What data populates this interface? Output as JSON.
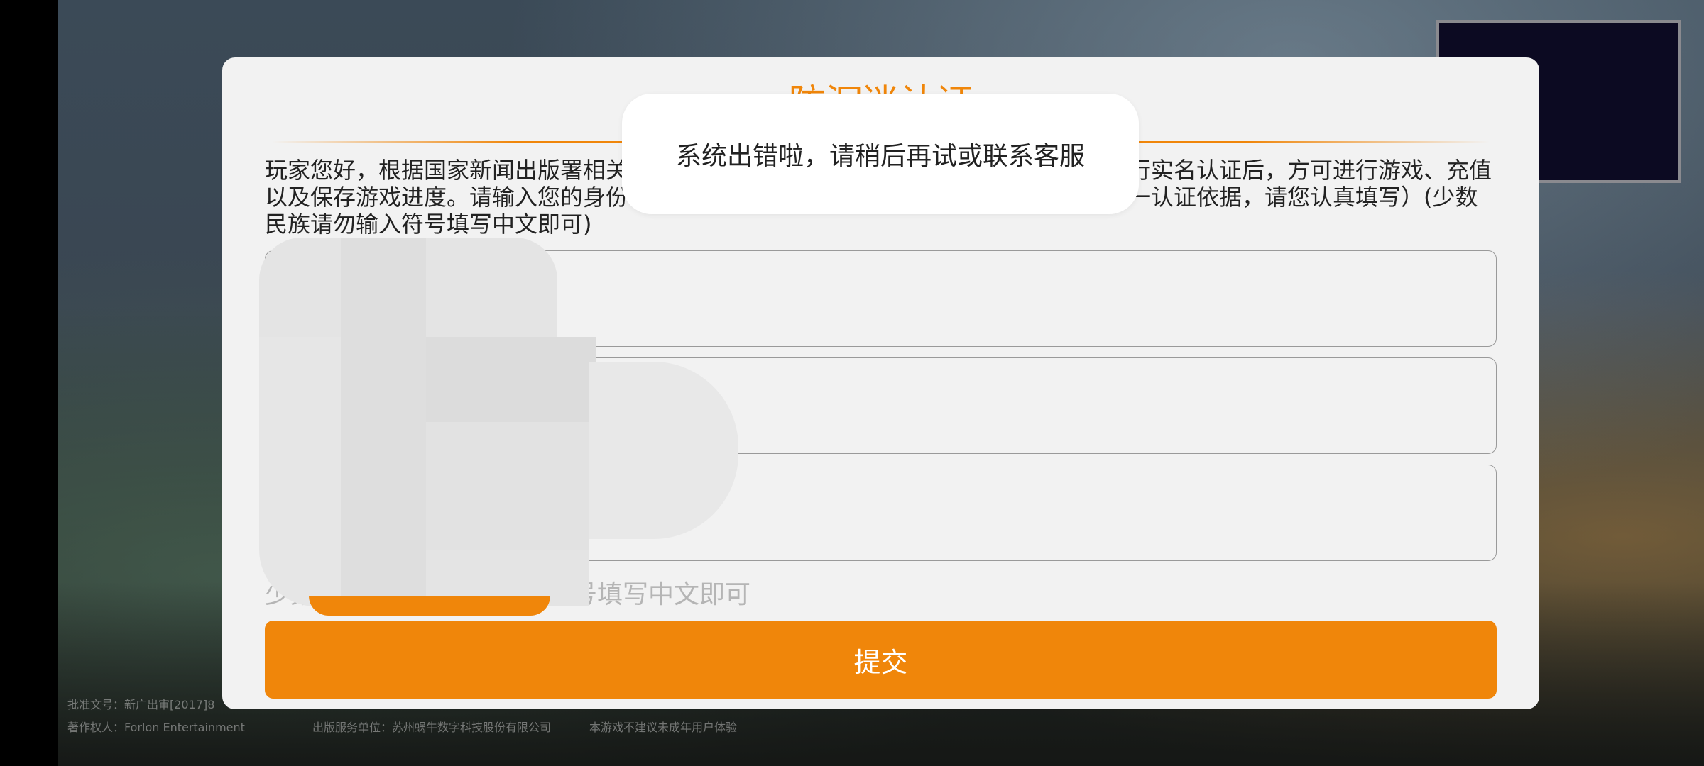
{
  "dialog": {
    "title": "防沉迷认证",
    "notice": "玩家您好，根据国家新闻出版署相关规定，所有网络游戏用户均须使用有效身份信息进行实名认证后，方可进行游戏、充值以及保存游戏进度。请输入您的身份证号码、姓名及手机号进行身份验证（该信息为唯一认证依据，请您认真填写）(少数民族请勿输入符号填写中文即可)",
    "field_1_value": "",
    "field_2_value": "",
    "field_3_value": "",
    "hint": "少数民族姓名，请勿输入符号填写中文即可",
    "submit_label": "提交"
  },
  "toast": {
    "message": "系统出错啦，请稍后再试或联系客服"
  },
  "footer": {
    "approval": "批准文号：新广出审[2017]8",
    "copyright": "著作权人：Forlon Entertainment",
    "publisher": "出版服务单位：苏州蜗牛数字科技股份有限公司",
    "age_notice": "本游戏不建议未成年用户体验"
  },
  "colors": {
    "accent": "#f0860a",
    "dialog_bg": "#f2f2f2",
    "pip_bg": "#0c0a22"
  }
}
